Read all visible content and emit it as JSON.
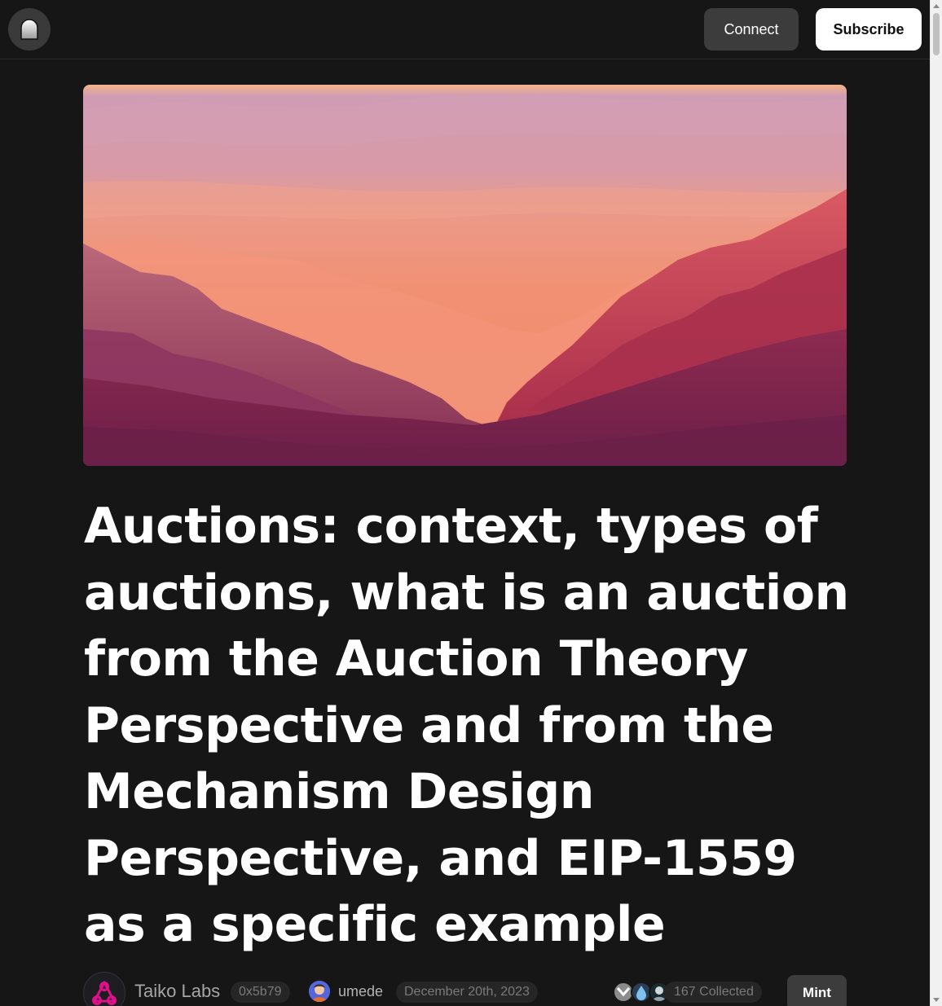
{
  "header": {
    "logo_icon": "mirror-arch-icon",
    "connect_label": "Connect",
    "subscribe_label": "Subscribe"
  },
  "cover": {
    "icon": "mountain-sunset-illustration",
    "colors": [
      "#d59aae",
      "#f08a72",
      "#cc3f56",
      "#7e1f45"
    ]
  },
  "article": {
    "title": "Auctions: context, types of auctions, what is an auction from the Auction Theory Perspective and from the Mechanism Design Perspective, and EIP-1559 as a specific example"
  },
  "byline": {
    "publication_icon": "taiko-logo-icon",
    "publication_name": "Taiko Labs",
    "publication_address": "0x5b79",
    "author_icon": "author-avatar-icon",
    "author_name": "umede",
    "date": "December 20th, 2023",
    "collected_text": "167 Collected",
    "mint_label": "Mint",
    "accent_color": "#e0108a"
  }
}
